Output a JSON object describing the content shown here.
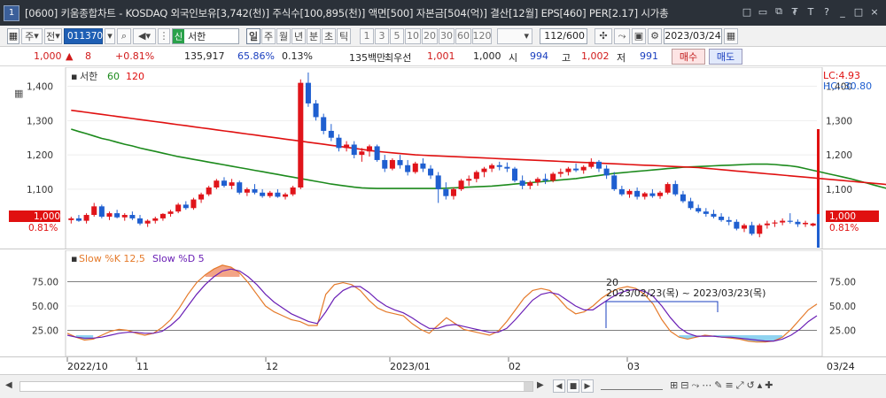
{
  "window": {
    "code_badge": "1",
    "title": "[0600] 키움종합차트 - KOSDAQ 외국인보유[3,742(천)] 주식수[100,895(천)] 액면[500] 자본금[504(억)] 결산[12월] EPS[460] PER[2.17] 시가총",
    "buttons": [
      "□",
      "▭",
      "⧉",
      "₮",
      "T",
      "?",
      "_",
      "□",
      "×"
    ]
  },
  "toolbar": {
    "market": "주",
    "jeon": "전",
    "code": "011370",
    "name": "서한",
    "sin": "신",
    "periods": [
      "일",
      "주",
      "월",
      "년",
      "분",
      "초",
      "틱"
    ],
    "active_period": "일",
    "minutes": [
      "1",
      "3",
      "5",
      "10",
      "20",
      "30",
      "60",
      "120"
    ],
    "count": "112/600",
    "date": "2023/03/24"
  },
  "quote": {
    "price": "1,000",
    "arrow": "▲",
    "change": "8",
    "change_pct": "+0.81%",
    "volume": "135,917",
    "vol_ratio": "65.86%",
    "turnover": "0.13%",
    "amount": "135백만",
    "best_label": "최우선",
    "ask": "1,001",
    "bid": "1,000",
    "open_label": "시",
    "open": "994",
    "high_label": "고",
    "high": "1,002",
    "low_label": "저",
    "low": "991",
    "buy": "매수",
    "sell": "매도"
  },
  "price_chart": {
    "legend_name": "서한",
    "legend_ma1": "60",
    "legend_ma2": "120",
    "lc_label": "LC:4.93",
    "hc_label": "HC:-30.80",
    "price_tag": "1,000",
    "pct_tag": "0.81%",
    "y_ticks": [
      "1,400",
      "1,300",
      "1,200",
      "1,100"
    ],
    "y_values": [
      1400,
      1300,
      1200,
      1100
    ],
    "ylim": [
      940,
      1440
    ],
    "last": 1000,
    "colors": {
      "up": "#e0141a",
      "down": "#1f5fd0",
      "ma60": "#1c8a1c",
      "ma120": "#e01010"
    }
  },
  "stoch_chart": {
    "legend_k": "Slow %K 12,5",
    "legend_d": "Slow %D 5",
    "y_ticks": [
      "75.00",
      "50.00",
      "25.00"
    ],
    "y_values": [
      75,
      50,
      25
    ],
    "ylim": [
      0,
      100
    ],
    "annotation_value": "20",
    "annotation_range": "2023/02/23(목) ~ 2023/03/23(목)",
    "colors": {
      "k": "#e57a2a",
      "d": "#6a1fb5"
    }
  },
  "x_axis": {
    "labels": [
      "2022/10",
      "11",
      "12",
      "2023/01",
      "02",
      "03"
    ],
    "right_label": "03/24"
  },
  "chart_data": [
    {
      "type": "candlestick",
      "x_first": "2022/10",
      "x_last": "03/24",
      "x_labels": [
        "2022/10",
        "11",
        "12",
        "2023/01",
        "02",
        "03"
      ],
      "ylim": [
        940,
        1440
      ],
      "series": [
        {
          "name": "60",
          "values": [
            1275,
            1268,
            1262,
            1255,
            1248,
            1243,
            1237,
            1231,
            1226,
            1220,
            1215,
            1210,
            1205,
            1200,
            1195,
            1191,
            1187,
            1183,
            1179,
            1175,
            1171,
            1167,
            1163,
            1159,
            1155,
            1151,
            1147,
            1143,
            1139,
            1135,
            1131,
            1127,
            1123,
            1119,
            1115,
            1112,
            1109,
            1106,
            1104,
            1103,
            1102,
            1102,
            1102,
            1102,
            1102,
            1102,
            1102,
            1102,
            1102,
            1103,
            1104,
            1105,
            1106,
            1107,
            1108,
            1109,
            1111,
            1113,
            1115,
            1117,
            1119,
            1121,
            1123,
            1125,
            1127,
            1129,
            1131,
            1134,
            1137,
            1140,
            1143,
            1146,
            1148,
            1150,
            1152,
            1154,
            1156,
            1158,
            1160,
            1162,
            1164,
            1165,
            1166,
            1167,
            1168,
            1169,
            1170,
            1171,
            1172,
            1173,
            1173,
            1173,
            1172,
            1170,
            1168,
            1165,
            1160,
            1155,
            1150,
            1145,
            1140,
            1135,
            1130,
            1124,
            1118,
            1112,
            1106,
            1100,
            1096,
            1093,
            1092,
            1092
          ]
        },
        {
          "name": "120",
          "values": [
            1330,
            1327,
            1324,
            1321,
            1318,
            1315,
            1312,
            1309,
            1306,
            1303,
            1300,
            1297,
            1294,
            1291,
            1288,
            1285,
            1282,
            1279,
            1276,
            1273,
            1270,
            1267,
            1264,
            1261,
            1258,
            1255,
            1252,
            1249,
            1246,
            1243,
            1240,
            1237,
            1234,
            1231,
            1228,
            1225,
            1222,
            1219,
            1216,
            1213,
            1210,
            1208,
            1206,
            1204,
            1202,
            1200,
            1199,
            1198,
            1197,
            1196,
            1195,
            1194,
            1193,
            1192,
            1191,
            1190,
            1189,
            1188,
            1187,
            1186,
            1185,
            1184,
            1183,
            1182,
            1181,
            1180,
            1179,
            1178,
            1177,
            1176,
            1175,
            1174,
            1173,
            1172,
            1171,
            1170,
            1169,
            1168,
            1167,
            1166,
            1165,
            1164,
            1163,
            1161,
            1159,
            1157,
            1155,
            1153,
            1151,
            1149,
            1147,
            1145,
            1143,
            1141,
            1139,
            1137,
            1135,
            1133,
            1131,
            1129,
            1127,
            1125,
            1123,
            1121,
            1119,
            1117,
            1115,
            1113,
            1111,
            1110,
            1109,
            1109
          ]
        }
      ],
      "candles": [
        [
          1010,
          1020,
          1000,
          1015
        ],
        [
          1015,
          1025,
          1005,
          1008
        ],
        [
          1008,
          1030,
          1000,
          1025
        ],
        [
          1025,
          1060,
          1020,
          1050
        ],
        [
          1050,
          1055,
          1015,
          1020
        ],
        [
          1020,
          1035,
          1010,
          1030
        ],
        [
          1030,
          1040,
          1015,
          1018
        ],
        [
          1018,
          1030,
          1008,
          1025
        ],
        [
          1025,
          1035,
          1010,
          1015
        ],
        [
          1015,
          1025,
          995,
          1000
        ],
        [
          1000,
          1012,
          990,
          1008
        ],
        [
          1008,
          1020,
          1000,
          1015
        ],
        [
          1015,
          1030,
          1008,
          1028
        ],
        [
          1028,
          1040,
          1020,
          1035
        ],
        [
          1035,
          1060,
          1030,
          1055
        ],
        [
          1055,
          1065,
          1040,
          1045
        ],
        [
          1045,
          1075,
          1040,
          1070
        ],
        [
          1070,
          1090,
          1060,
          1085
        ],
        [
          1085,
          1110,
          1080,
          1105
        ],
        [
          1105,
          1130,
          1100,
          1125
        ],
        [
          1125,
          1135,
          1105,
          1110
        ],
        [
          1110,
          1130,
          1100,
          1120
        ],
        [
          1120,
          1125,
          1085,
          1090
        ],
        [
          1090,
          1105,
          1080,
          1100
        ],
        [
          1100,
          1115,
          1085,
          1090
        ],
        [
          1090,
          1100,
          1075,
          1080
        ],
        [
          1080,
          1095,
          1075,
          1090
        ],
        [
          1090,
          1100,
          1075,
          1078
        ],
        [
          1078,
          1090,
          1070,
          1085
        ],
        [
          1085,
          1110,
          1080,
          1105
        ],
        [
          1105,
          1420,
          1100,
          1410
        ],
        [
          1410,
          1440,
          1340,
          1350
        ],
        [
          1350,
          1360,
          1300,
          1310
        ],
        [
          1310,
          1320,
          1260,
          1270
        ],
        [
          1270,
          1290,
          1240,
          1250
        ],
        [
          1250,
          1260,
          1210,
          1220
        ],
        [
          1220,
          1240,
          1210,
          1230
        ],
        [
          1230,
          1240,
          1190,
          1200
        ],
        [
          1200,
          1220,
          1180,
          1210
        ],
        [
          1210,
          1230,
          1195,
          1225
        ],
        [
          1225,
          1230,
          1180,
          1185
        ],
        [
          1185,
          1200,
          1150,
          1160
        ],
        [
          1160,
          1190,
          1155,
          1185
        ],
        [
          1185,
          1200,
          1160,
          1170
        ],
        [
          1170,
          1185,
          1140,
          1150
        ],
        [
          1150,
          1180,
          1145,
          1175
        ],
        [
          1175,
          1190,
          1150,
          1160
        ],
        [
          1160,
          1170,
          1130,
          1140
        ],
        [
          1140,
          1150,
          1060,
          1100
        ],
        [
          1100,
          1120,
          1070,
          1080
        ],
        [
          1080,
          1105,
          1070,
          1100
        ],
        [
          1100,
          1130,
          1095,
          1125
        ],
        [
          1125,
          1140,
          1110,
          1130
        ],
        [
          1130,
          1155,
          1120,
          1150
        ],
        [
          1150,
          1165,
          1135,
          1160
        ],
        [
          1160,
          1175,
          1150,
          1170
        ],
        [
          1170,
          1180,
          1155,
          1165
        ],
        [
          1165,
          1178,
          1150,
          1160
        ],
        [
          1160,
          1165,
          1120,
          1125
        ],
        [
          1125,
          1140,
          1100,
          1110
        ],
        [
          1110,
          1125,
          1100,
          1120
        ],
        [
          1120,
          1135,
          1110,
          1130
        ],
        [
          1130,
          1145,
          1115,
          1125
        ],
        [
          1125,
          1150,
          1120,
          1145
        ],
        [
          1145,
          1160,
          1135,
          1150
        ],
        [
          1150,
          1165,
          1140,
          1160
        ],
        [
          1160,
          1175,
          1150,
          1155
        ],
        [
          1155,
          1170,
          1145,
          1165
        ],
        [
          1165,
          1190,
          1160,
          1180
        ],
        [
          1180,
          1185,
          1150,
          1160
        ],
        [
          1160,
          1170,
          1130,
          1140
        ],
        [
          1140,
          1150,
          1095,
          1100
        ],
        [
          1100,
          1110,
          1080,
          1085
        ],
        [
          1085,
          1100,
          1075,
          1095
        ],
        [
          1095,
          1105,
          1070,
          1078
        ],
        [
          1078,
          1092,
          1070,
          1088
        ],
        [
          1088,
          1100,
          1075,
          1080
        ],
        [
          1080,
          1095,
          1072,
          1090
        ],
        [
          1090,
          1120,
          1085,
          1115
        ],
        [
          1115,
          1125,
          1080,
          1085
        ],
        [
          1085,
          1095,
          1060,
          1065
        ],
        [
          1065,
          1075,
          1040,
          1045
        ],
        [
          1045,
          1055,
          1030,
          1035
        ],
        [
          1035,
          1045,
          1020,
          1028
        ],
        [
          1028,
          1040,
          1015,
          1020
        ],
        [
          1020,
          1030,
          1005,
          1010
        ],
        [
          1010,
          1020,
          995,
          1005
        ],
        [
          1005,
          1012,
          980,
          985
        ],
        [
          985,
          1000,
          975,
          995
        ],
        [
          995,
          1005,
          965,
          970
        ],
        [
          970,
          1000,
          960,
          995
        ],
        [
          995,
          1008,
          985,
          1000
        ],
        [
          1000,
          1010,
          990,
          1003
        ],
        [
          1003,
          1015,
          995,
          1008
        ],
        [
          1008,
          1030,
          1000,
          1005
        ],
        [
          1005,
          1012,
          990,
          998
        ],
        [
          998,
          1008,
          990,
          1002
        ],
        [
          994,
          1002,
          991,
          1000
        ]
      ],
      "candle_fields": [
        "open",
        "high",
        "low",
        "close"
      ]
    },
    {
      "type": "line",
      "title": "",
      "ylim": [
        0,
        100
      ],
      "series": [
        {
          "name": "Slow %K 12,5",
          "values": [
            22,
            18,
            15,
            16,
            20,
            24,
            26,
            25,
            22,
            20,
            22,
            28,
            36,
            48,
            62,
            74,
            82,
            88,
            92,
            90,
            84,
            74,
            62,
            50,
            44,
            40,
            36,
            34,
            30,
            30,
            62,
            72,
            74,
            72,
            66,
            56,
            48,
            44,
            42,
            40,
            32,
            26,
            22,
            30,
            38,
            32,
            26,
            24,
            22,
            20,
            24,
            34,
            46,
            58,
            66,
            68,
            66,
            58,
            48,
            42,
            44,
            50,
            58,
            64,
            68,
            70,
            68,
            62,
            52,
            36,
            24,
            18,
            16,
            18,
            20,
            19,
            18,
            17,
            16,
            14,
            13,
            13,
            14,
            18,
            26,
            36,
            46,
            52
          ]
        },
        {
          "name": "Slow %D 5",
          "values": [
            20,
            18,
            17,
            17,
            18,
            20,
            22,
            23,
            23,
            22,
            22,
            24,
            30,
            38,
            50,
            62,
            72,
            80,
            86,
            88,
            86,
            80,
            72,
            62,
            54,
            48,
            42,
            38,
            34,
            32,
            44,
            58,
            66,
            70,
            70,
            64,
            56,
            50,
            46,
            43,
            38,
            32,
            27,
            27,
            30,
            31,
            29,
            27,
            25,
            23,
            23,
            27,
            36,
            46,
            56,
            62,
            64,
            62,
            56,
            50,
            46,
            46,
            52,
            58,
            63,
            66,
            67,
            65,
            60,
            50,
            38,
            28,
            22,
            19,
            19,
            19,
            18,
            18,
            17,
            16,
            15,
            14,
            14,
            16,
            20,
            26,
            34,
            40
          ]
        }
      ]
    }
  ]
}
